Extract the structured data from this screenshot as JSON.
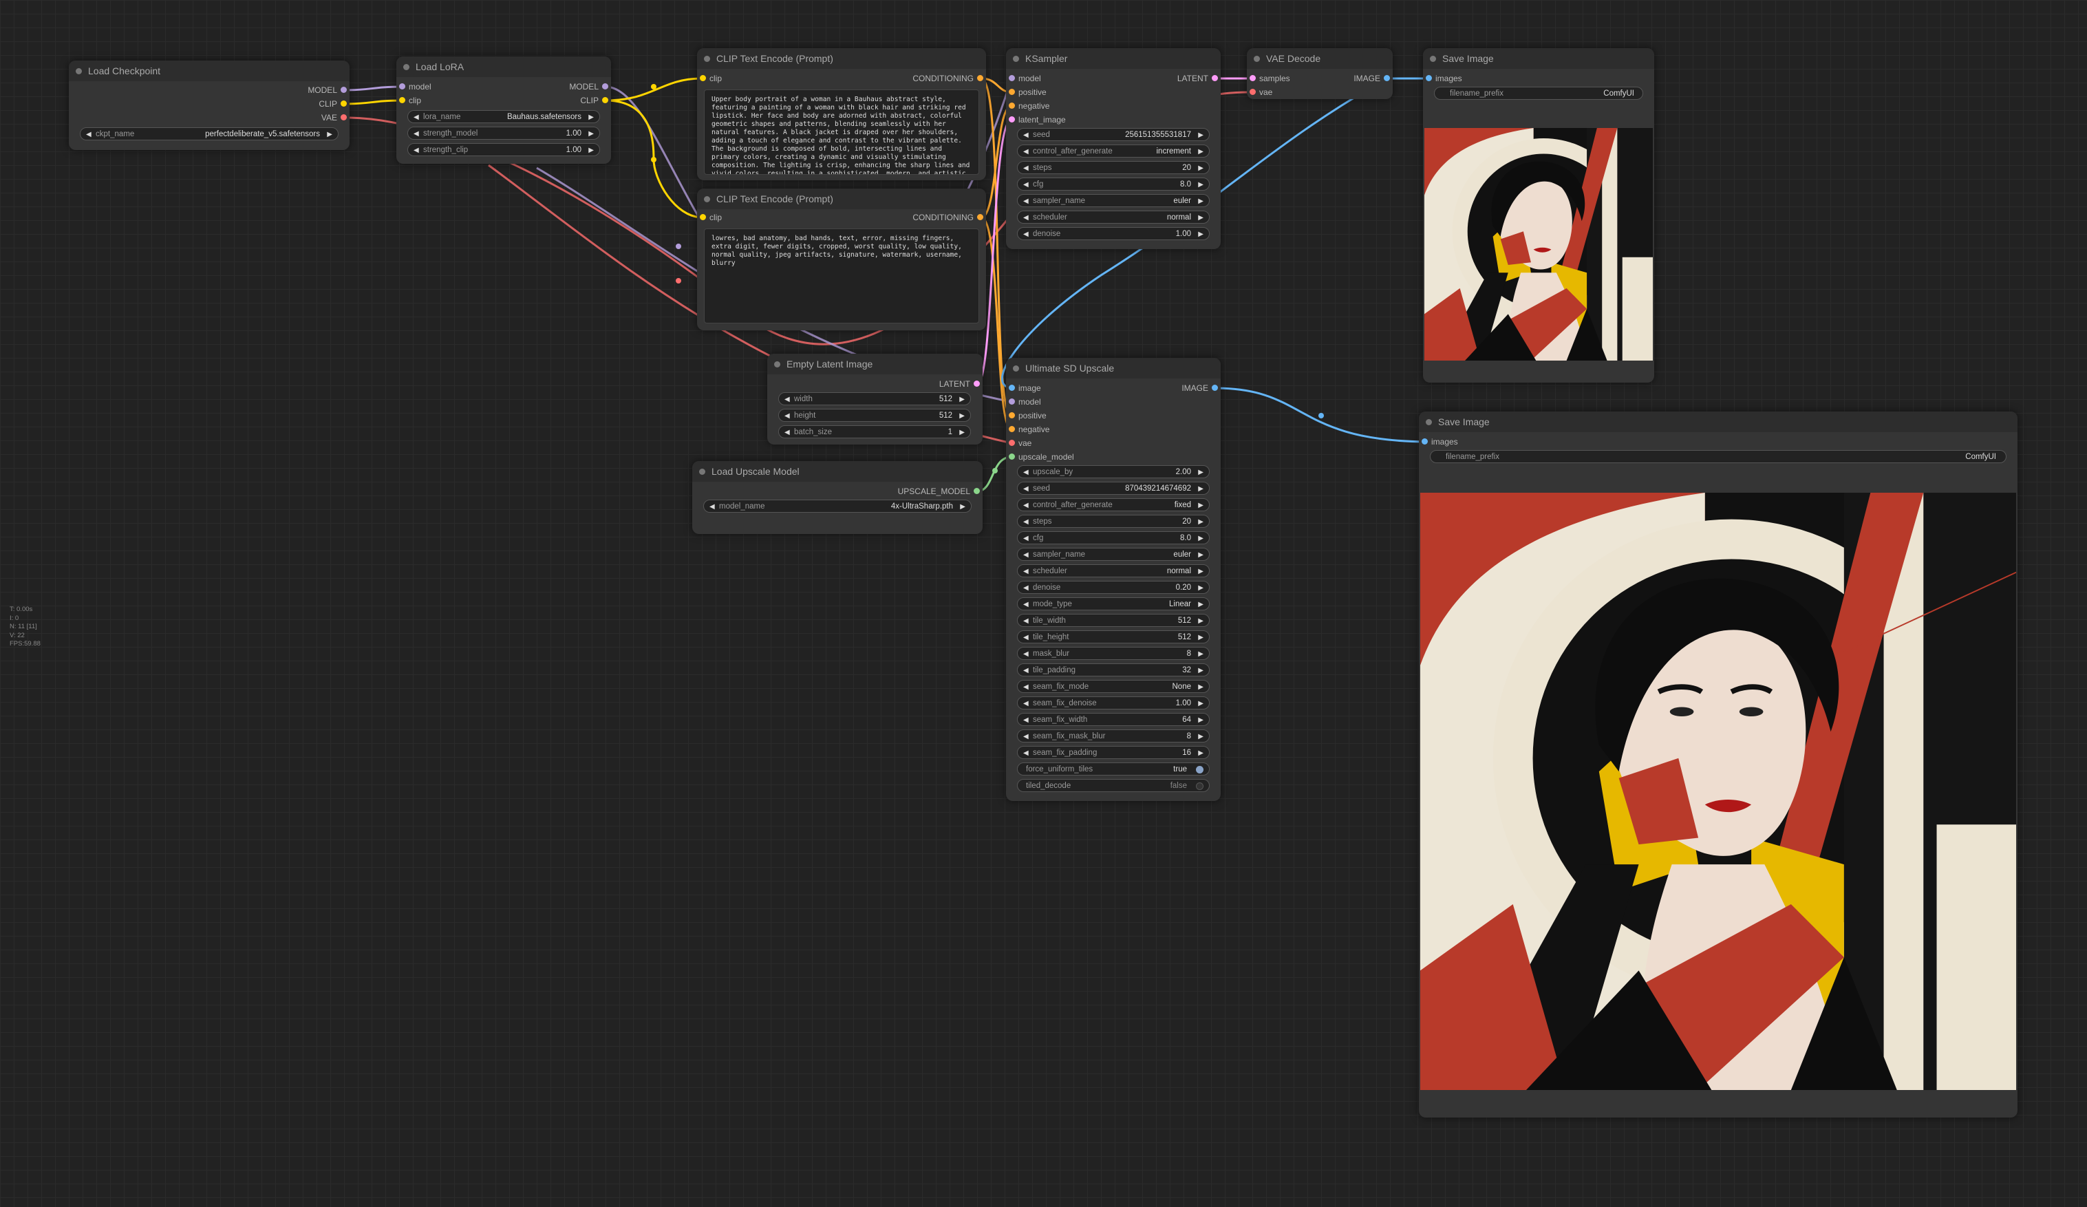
{
  "colors": {
    "model": "#b39ddb",
    "clip": "#ffd500",
    "vae": "#ff6e6e",
    "conditioning": "#ffa931",
    "latent": "#ff9cf9",
    "image": "#64b5f6",
    "upscale_model": "#8bd68b"
  },
  "stats": {
    "lines": [
      "T: 0.00s",
      "I: 0",
      "N: 11 [11]",
      "V: 22",
      "FPS:59.88"
    ]
  },
  "nodes": {
    "load_checkpoint": {
      "title": "Load Checkpoint",
      "outputs": [
        "MODEL",
        "CLIP",
        "VAE"
      ],
      "widgets": [
        {
          "name": "ckpt_name",
          "value": "perfectdeliberate_v5.safetensors"
        }
      ]
    },
    "load_lora": {
      "title": "Load LoRA",
      "inputs": [
        "model",
        "clip"
      ],
      "outputs": [
        "MODEL",
        "CLIP"
      ],
      "widgets": [
        {
          "name": "lora_name",
          "value": "Bauhaus.safetensors"
        },
        {
          "name": "strength_model",
          "value": "1.00"
        },
        {
          "name": "strength_clip",
          "value": "1.00"
        }
      ]
    },
    "clip_pos": {
      "title": "CLIP Text Encode (Prompt)",
      "inputs": [
        "clip"
      ],
      "outputs": [
        "CONDITIONING"
      ],
      "text": "Upper body portrait of a woman in a Bauhaus abstract style, featuring a painting of a woman with black hair and striking red lipstick. Her face and body are adorned with abstract, colorful geometric shapes and patterns, blending seamlessly with her natural features. A black jacket is draped over her shoulders, adding a touch of elegance and contrast to the vibrant palette. The background is composed of bold, intersecting lines and primary colors, creating a dynamic and visually stimulating composition. The lighting is crisp, enhancing the sharp lines and vivid colors, resulting in a sophisticated, modern, and artistic portrayal."
    },
    "clip_neg": {
      "title": "CLIP Text Encode (Prompt)",
      "inputs": [
        "clip"
      ],
      "outputs": [
        "CONDITIONING"
      ],
      "text": "lowres, bad anatomy, bad hands, text, error, missing fingers, extra digit, fewer digits, cropped, worst quality, low quality, normal quality, jpeg artifacts, signature, watermark, username, blurry"
    },
    "ksampler": {
      "title": "KSampler",
      "inputs": [
        "model",
        "positive",
        "negative",
        "latent_image"
      ],
      "outputs": [
        "LATENT"
      ],
      "widgets": [
        {
          "name": "seed",
          "value": "256151355531817"
        },
        {
          "name": "control_after_generate",
          "value": "increment"
        },
        {
          "name": "steps",
          "value": "20"
        },
        {
          "name": "cfg",
          "value": "8.0"
        },
        {
          "name": "sampler_name",
          "value": "euler"
        },
        {
          "name": "scheduler",
          "value": "normal"
        },
        {
          "name": "denoise",
          "value": "1.00"
        }
      ]
    },
    "vae_decode": {
      "title": "VAE Decode",
      "inputs": [
        "samples",
        "vae"
      ],
      "outputs": [
        "IMAGE"
      ]
    },
    "save_image_1": {
      "title": "Save Image",
      "inputs": [
        "images"
      ],
      "widgets": [
        {
          "name": "filename_prefix",
          "value": "ComfyUI"
        }
      ]
    },
    "empty_latent": {
      "title": "Empty Latent Image",
      "outputs": [
        "LATENT"
      ],
      "widgets": [
        {
          "name": "width",
          "value": "512"
        },
        {
          "name": "height",
          "value": "512"
        },
        {
          "name": "batch_size",
          "value": "1"
        }
      ]
    },
    "load_upscale": {
      "title": "Load Upscale Model",
      "outputs": [
        "UPSCALE_MODEL"
      ],
      "widgets": [
        {
          "name": "model_name",
          "value": "4x-UltraSharp.pth"
        }
      ]
    },
    "ultimate_upscale": {
      "title": "Ultimate SD Upscale",
      "inputs": [
        "image",
        "model",
        "positive",
        "negative",
        "vae",
        "upscale_model"
      ],
      "outputs": [
        "IMAGE"
      ],
      "widgets": [
        {
          "name": "upscale_by",
          "value": "2.00"
        },
        {
          "name": "seed",
          "value": "870439214674692"
        },
        {
          "name": "control_after_generate",
          "value": "fixed"
        },
        {
          "name": "steps",
          "value": "20"
        },
        {
          "name": "cfg",
          "value": "8.0"
        },
        {
          "name": "sampler_name",
          "value": "euler"
        },
        {
          "name": "scheduler",
          "value": "normal"
        },
        {
          "name": "denoise",
          "value": "0.20"
        },
        {
          "name": "mode_type",
          "value": "Linear"
        },
        {
          "name": "tile_width",
          "value": "512"
        },
        {
          "name": "tile_height",
          "value": "512"
        },
        {
          "name": "mask_blur",
          "value": "8"
        },
        {
          "name": "tile_padding",
          "value": "32"
        },
        {
          "name": "seam_fix_mode",
          "value": "None"
        },
        {
          "name": "seam_fix_denoise",
          "value": "1.00"
        },
        {
          "name": "seam_fix_width",
          "value": "64"
        },
        {
          "name": "seam_fix_mask_blur",
          "value": "8"
        },
        {
          "name": "seam_fix_padding",
          "value": "16"
        }
      ],
      "toggles": [
        {
          "name": "force_uniform_tiles",
          "value": "true"
        },
        {
          "name": "tiled_decode",
          "value": "false"
        }
      ]
    },
    "save_image_2": {
      "title": "Save Image",
      "inputs": [
        "images"
      ],
      "widgets": [
        {
          "name": "filename_prefix",
          "value": "ComfyUI"
        }
      ]
    }
  }
}
